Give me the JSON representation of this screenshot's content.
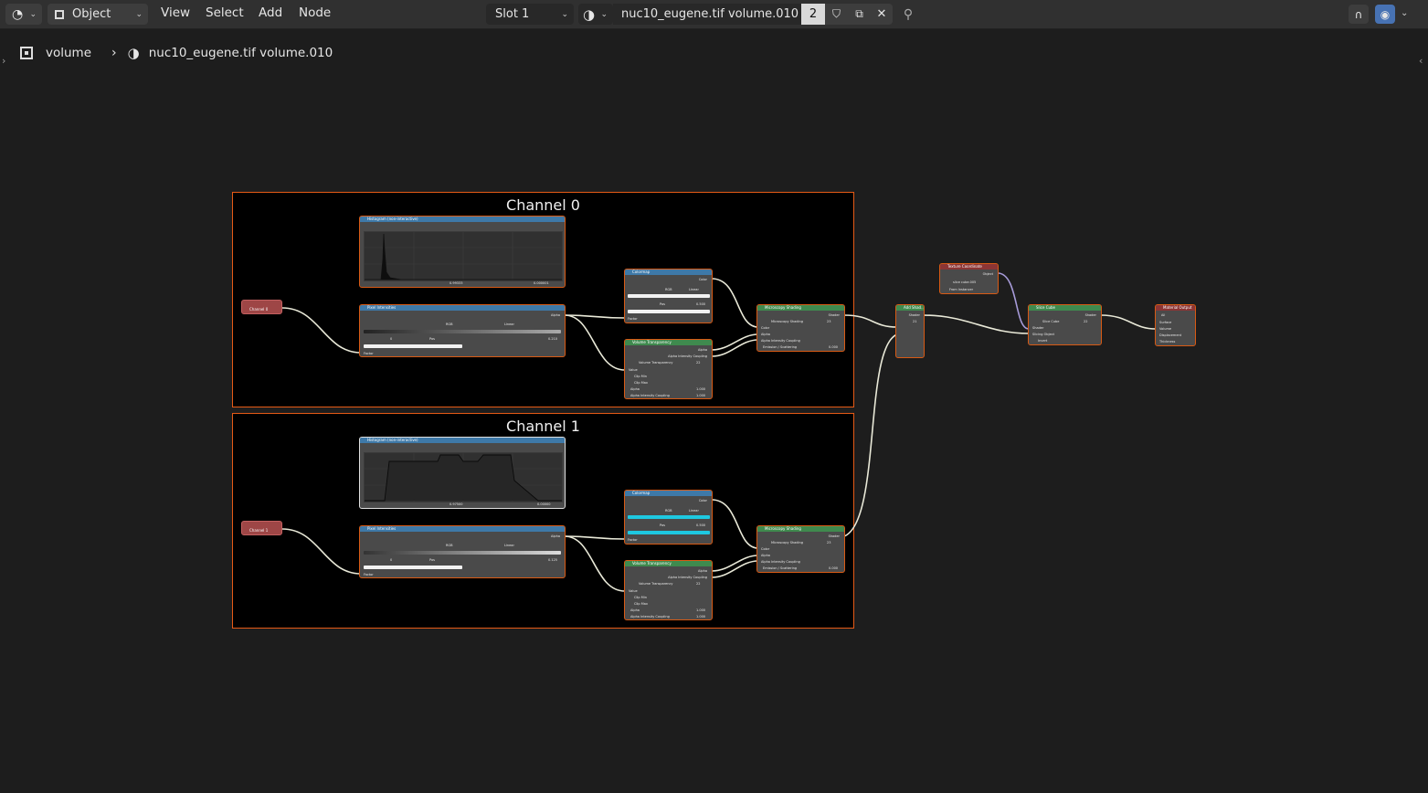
{
  "header": {
    "editor_type_icon": "node-editor-icon",
    "mode_label": "Object",
    "menus": [
      "View",
      "Select",
      "Add",
      "Node"
    ],
    "slot_label": "Slot 1",
    "material_name": "nuc10_eugene.tif volume.010",
    "user_count": "2"
  },
  "breadcrumb": {
    "object_name": "volume",
    "material_name": "nuc10_eugene.tif volume.010"
  },
  "frames": {
    "ch0_title": "Channel 0",
    "ch1_title": "Channel 1"
  },
  "nodes": {
    "hist_title": "Histogram (non-interactive)",
    "hist0_x": "0.99333",
    "hist0_y": "0.000001",
    "hist1_x": "0.97500",
    "hist1_y": "0.00000",
    "channel0_label": "Channel 0",
    "channel1_label": "Channel 1",
    "pixel_title": "Pixel Intensities",
    "alpha": "Alpha",
    "rgb": "RGB",
    "linear": "Linear",
    "pos": "Pos",
    "pix0_index": "0",
    "pix0_val": "0.210",
    "pix1_index": "0",
    "pix1_val": "0.125",
    "factor": "Factor",
    "colormap_title": "Colormap",
    "color": "Color",
    "cmap_pos_val": "0.500",
    "vt_title": "Volume Transparency",
    "alpha_intensity": "Alpha Intensity Coupling",
    "vt_group": "Volume Transparency",
    "vt_count": "22",
    "value": "Value",
    "clip_min": "Clip Min",
    "clip_max": "Clip Max",
    "one": "1.000",
    "ms_title": "Microscopy Shading",
    "shader": "Shader",
    "ms_group": "Microscopy Shading",
    "ms_count": "23",
    "emission": "Emission / Scattering",
    "zero": "0.000",
    "add_title": "Add Shad...",
    "add_count": "21",
    "tc_title": "Texture Coordinate",
    "object": "Object",
    "tc_object": "slice cube.005",
    "from_instancer": "From Instancer",
    "slice_title": "Slice Cube",
    "slice_group": "Slice Cube",
    "slice_count": "22",
    "slicing_object": "Slicing Object",
    "invert": "Invert",
    "mo_title": "Material Output",
    "mo_all": "All",
    "surface": "Surface",
    "volume": "Volume",
    "displacement": "Displacement",
    "thickness": "Thickness"
  },
  "colors": {
    "frame_border": "#e65a16",
    "node_header_blue": "#3e79a8",
    "node_header_green": "#3f8a4e",
    "node_header_red": "#8c3535",
    "wire": "#e9e9d8",
    "cyan_ramp": "#1ec8e0"
  }
}
